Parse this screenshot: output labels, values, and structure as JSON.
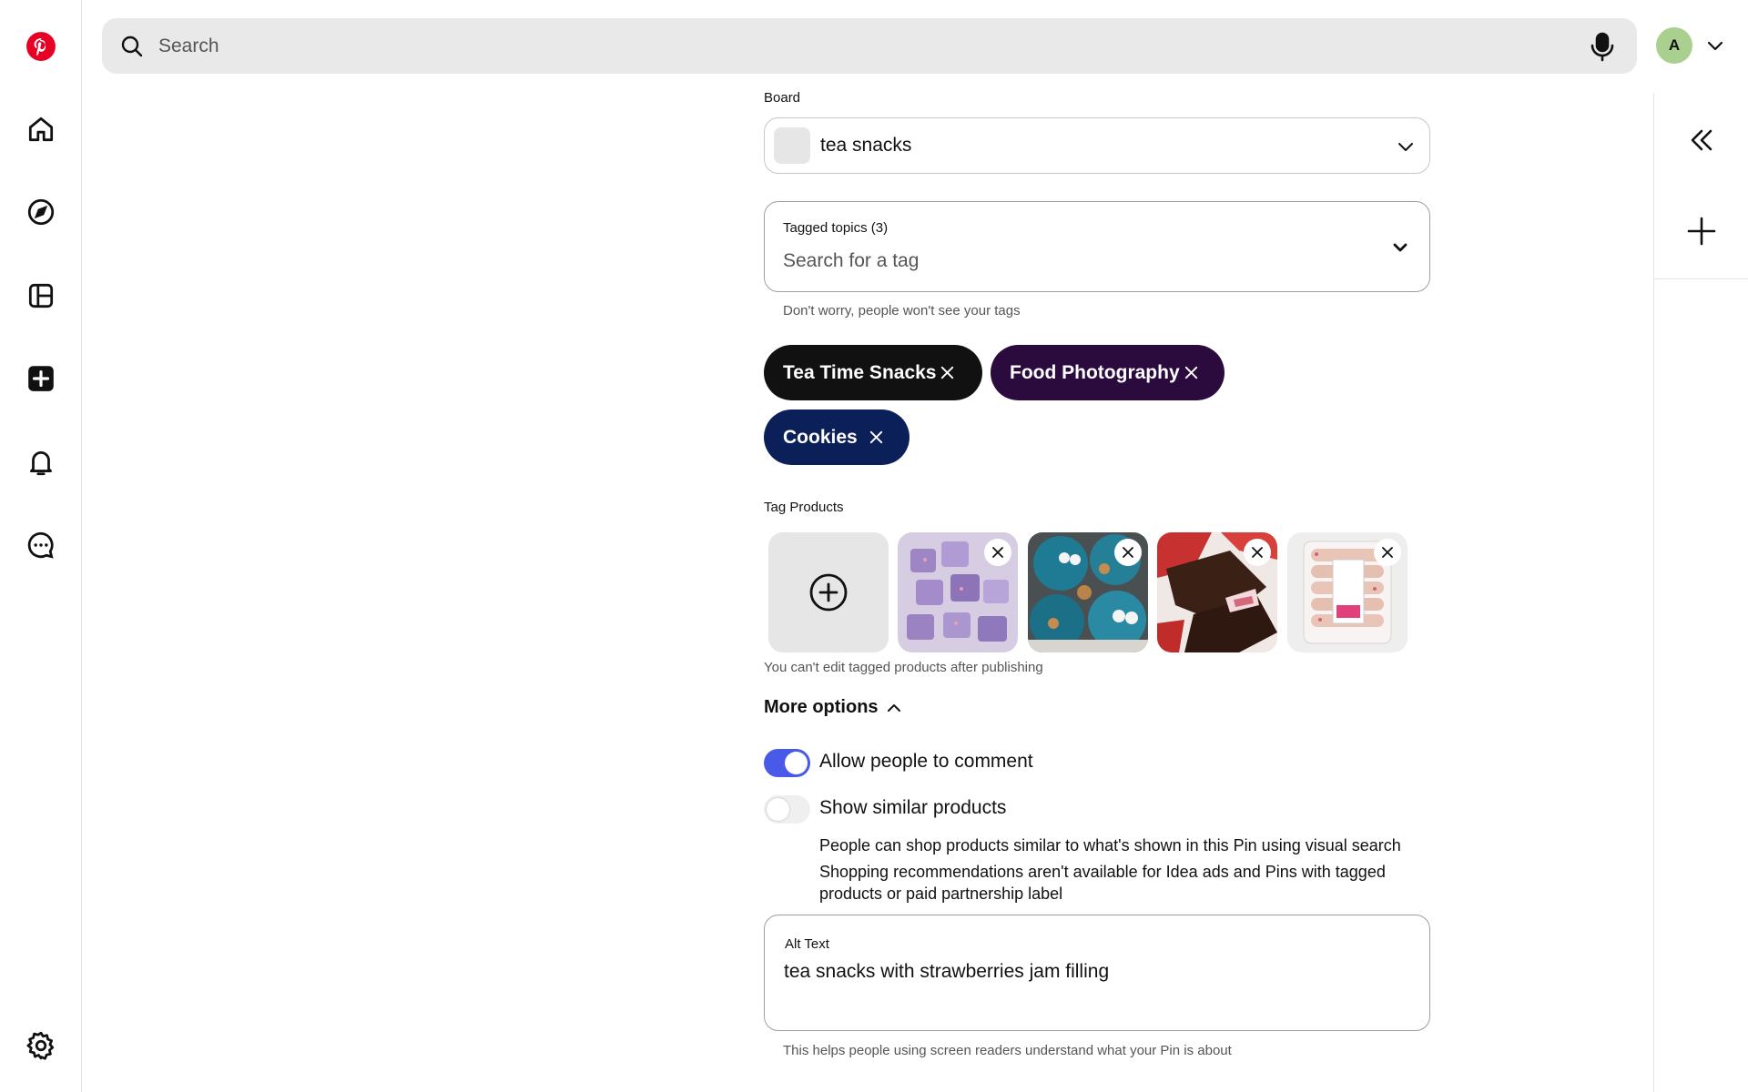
{
  "header": {
    "search_placeholder": "Search",
    "avatar_initial": "A"
  },
  "rail": {
    "items": [
      "pinterest-logo",
      "home",
      "explore",
      "boards",
      "create",
      "notifications",
      "messages",
      "settings"
    ]
  },
  "form": {
    "board_label": "Board",
    "board_value": "tea snacks",
    "tagged_topics_label": "Tagged topics (3)",
    "tag_search_placeholder": "Search for a tag",
    "tag_helper": "Don't worry, people won't see your tags",
    "tags": [
      {
        "label": "Tea Time Snacks",
        "color": "#111111"
      },
      {
        "label": "Food Photography",
        "color": "#2b0a3d"
      },
      {
        "label": "Cookies",
        "color": "#0b2059"
      }
    ],
    "tag_products_label": "Tag Products",
    "tag_products_helper": "You can't edit tagged products after publishing",
    "products": [
      "purple-candy-cubes",
      "blue-cookie-monster-cookies",
      "chocolate-strawberry-bark",
      "packaged-pink-cookies"
    ],
    "more_options_label": "More options",
    "allow_comments_label": "Allow people to comment",
    "allow_comments_on": true,
    "similar_products_label": "Show similar products",
    "similar_products_on": false,
    "similar_desc_1": "People can shop products similar to what's shown in this Pin using visual search",
    "similar_desc_2": "Shopping recommendations aren't available for Idea ads and Pins with tagged products or paid partnership label",
    "alt_text_label": "Alt Text",
    "alt_text_value": "tea snacks with strawberries jam filling",
    "alt_text_helper": "This helps people using screen readers understand what your Pin is about"
  },
  "colors": {
    "brand": "#e60023",
    "toggle_on": "#4a5ae8",
    "toggle_off": "#efefef"
  }
}
